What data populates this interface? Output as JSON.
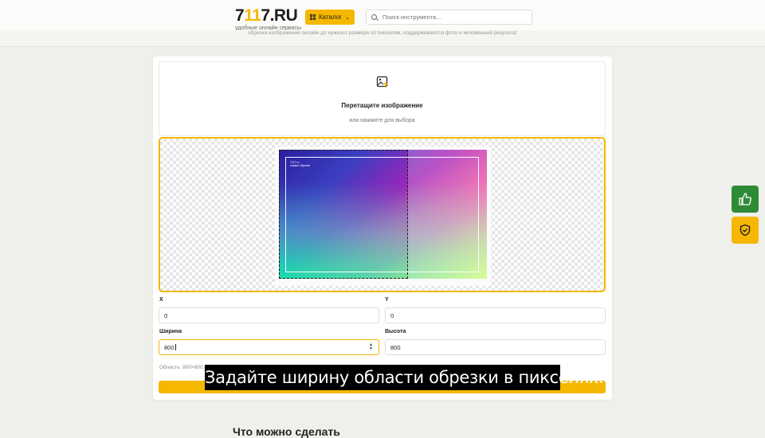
{
  "header": {
    "logo": {
      "prefix": "7",
      "accent": "11",
      "suffix": "7.RU",
      "tagline": "удобные онлайн сервисы"
    },
    "catalog_label": "Каталог",
    "search_placeholder": "Поиск инструмента..."
  },
  "description": "обрезка изображений онлайн до нужного размера по пикселям, поддерживаются фото и мгновенный результат",
  "upload": {
    "title": "Перетащите изображение",
    "hint": "или нажмите для выбора"
  },
  "preview": {
    "image_caption_line1": "7117.ru",
    "image_caption_line2": "сервис обрезки"
  },
  "form": {
    "x_label": "X",
    "x_value": "0",
    "y_label": "Y",
    "y_value": "0",
    "width_label": "Ширина",
    "width_value": "800",
    "height_label": "Высота",
    "height_value": "800",
    "area_info": "Область: 800×800 px"
  },
  "subtitle": "Задайте ширину области обрезки в пикселях.",
  "bottom_heading": "Что можно сделать",
  "colors": {
    "accent": "#f5b700",
    "like": "#2f8a36"
  }
}
